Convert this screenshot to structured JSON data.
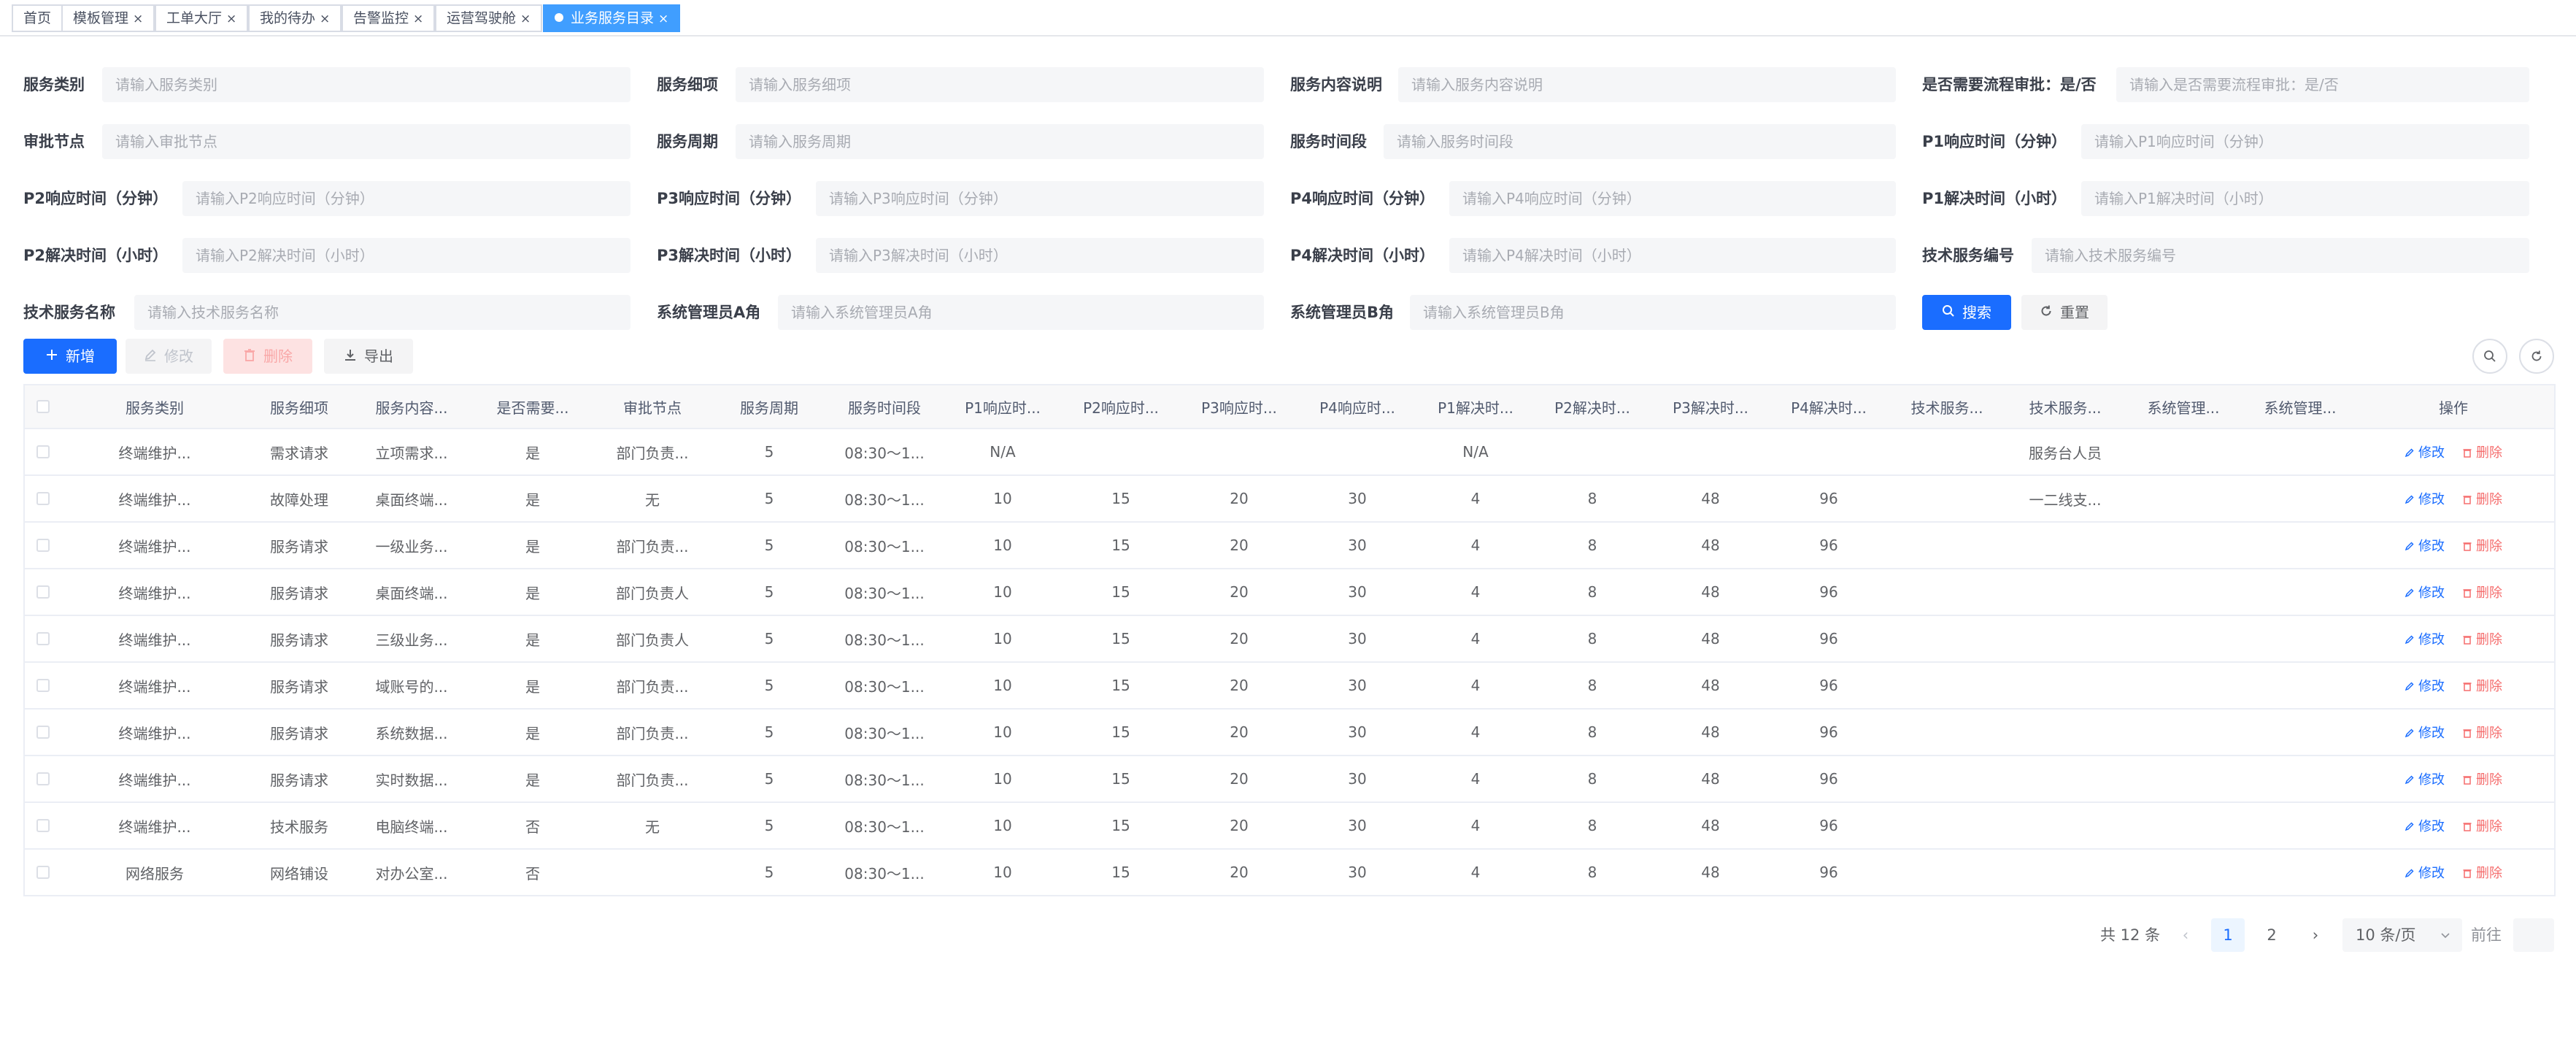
{
  "tags": [
    {
      "label": "首页",
      "closable": false,
      "active": false
    },
    {
      "label": "模板管理",
      "closable": true,
      "active": false
    },
    {
      "label": "工单大厅",
      "closable": true,
      "active": false
    },
    {
      "label": "我的待办",
      "closable": true,
      "active": false
    },
    {
      "label": "告警监控",
      "closable": true,
      "active": false
    },
    {
      "label": "运营驾驶舱",
      "closable": true,
      "active": false
    },
    {
      "label": "业务服务目录",
      "closable": true,
      "active": true
    }
  ],
  "close_glyph": "×",
  "form": {
    "fields": [
      {
        "label": "服务类别",
        "placeholder": "请输入服务类别"
      },
      {
        "label": "服务细项",
        "placeholder": "请输入服务细项"
      },
      {
        "label": "服务内容说明",
        "placeholder": "请输入服务内容说明"
      },
      {
        "label": "是否需要流程审批：是/否",
        "placeholder": "请输入是否需要流程审批：是/否"
      },
      {
        "label": "审批节点",
        "placeholder": "请输入审批节点"
      },
      {
        "label": "服务周期",
        "placeholder": "请输入服务周期"
      },
      {
        "label": "服务时间段",
        "placeholder": "请输入服务时间段"
      },
      {
        "label": "P1响应时间（分钟）",
        "placeholder": "请输入P1响应时间（分钟）"
      },
      {
        "label": "P2响应时间（分钟）",
        "placeholder": "请输入P2响应时间（分钟）"
      },
      {
        "label": "P3响应时间（分钟）",
        "placeholder": "请输入P3响应时间（分钟）"
      },
      {
        "label": "P4响应时间（分钟）",
        "placeholder": "请输入P4响应时间（分钟）"
      },
      {
        "label": "P1解决时间（小时）",
        "placeholder": "请输入P1解决时间（小时）"
      },
      {
        "label": "P2解决时间（小时）",
        "placeholder": "请输入P2解决时间（小时）"
      },
      {
        "label": "P3解决时间（小时）",
        "placeholder": "请输入P3解决时间（小时）"
      },
      {
        "label": "P4解决时间（小时）",
        "placeholder": "请输入P4解决时间（小时）"
      },
      {
        "label": "技术服务编号",
        "placeholder": "请输入技术服务编号"
      },
      {
        "label": "技术服务名称",
        "placeholder": "请输入技术服务名称"
      },
      {
        "label": "系统管理员A角",
        "placeholder": "请输入系统管理员A角"
      },
      {
        "label": "系统管理员B角",
        "placeholder": "请输入系统管理员B角"
      }
    ],
    "search_label": "搜索",
    "reset_label": "重置"
  },
  "toolbar": {
    "add_label": "新增",
    "edit_label": "修改",
    "delete_label": "删除",
    "export_label": "导出"
  },
  "table": {
    "headers": [
      "服务类别",
      "服务细项",
      "服务内容...",
      "是否需要...",
      "审批节点",
      "服务周期",
      "服务时间段",
      "P1响应时...",
      "P2响应时...",
      "P3响应时...",
      "P4响应时...",
      "P1解决时...",
      "P2解决时...",
      "P3解决时...",
      "P4解决时...",
      "技术服务...",
      "技术服务...",
      "系统管理...",
      "系统管理...",
      "操作"
    ],
    "row_edit_label": "修改",
    "row_delete_label": "删除",
    "rows": [
      [
        "终端维护...",
        "需求请求",
        "立项需求...",
        "是",
        "部门负责...",
        "5",
        "08:30～1...",
        "N/A",
        "",
        "",
        "",
        "N/A",
        "",
        "",
        "",
        "",
        "服务台人员",
        "",
        ""
      ],
      [
        "终端维护...",
        "故障处理",
        "桌面终端...",
        "是",
        "无",
        "5",
        "08:30～1...",
        "10",
        "15",
        "20",
        "30",
        "4",
        "8",
        "48",
        "96",
        "",
        "一二线支...",
        "",
        ""
      ],
      [
        "终端维护...",
        "服务请求",
        "一级业务...",
        "是",
        "部门负责...",
        "5",
        "08:30～1...",
        "10",
        "15",
        "20",
        "30",
        "4",
        "8",
        "48",
        "96",
        "",
        "",
        "",
        ""
      ],
      [
        "终端维护...",
        "服务请求",
        "桌面终端...",
        "是",
        "部门负责人",
        "5",
        "08:30～1...",
        "10",
        "15",
        "20",
        "30",
        "4",
        "8",
        "48",
        "96",
        "",
        "",
        "",
        ""
      ],
      [
        "终端维护...",
        "服务请求",
        "三级业务...",
        "是",
        "部门负责人",
        "5",
        "08:30～1...",
        "10",
        "15",
        "20",
        "30",
        "4",
        "8",
        "48",
        "96",
        "",
        "",
        "",
        ""
      ],
      [
        "终端维护...",
        "服务请求",
        "域账号的...",
        "是",
        "部门负责...",
        "5",
        "08:30～1...",
        "10",
        "15",
        "20",
        "30",
        "4",
        "8",
        "48",
        "96",
        "",
        "",
        "",
        ""
      ],
      [
        "终端维护...",
        "服务请求",
        "系统数据...",
        "是",
        "部门负责...",
        "5",
        "08:30～1...",
        "10",
        "15",
        "20",
        "30",
        "4",
        "8",
        "48",
        "96",
        "",
        "",
        "",
        ""
      ],
      [
        "终端维护...",
        "服务请求",
        "实时数据...",
        "是",
        "部门负责...",
        "5",
        "08:30～1...",
        "10",
        "15",
        "20",
        "30",
        "4",
        "8",
        "48",
        "96",
        "",
        "",
        "",
        ""
      ],
      [
        "终端维护...",
        "技术服务",
        "电脑终端...",
        "否",
        "无",
        "5",
        "08:30～1...",
        "10",
        "15",
        "20",
        "30",
        "4",
        "8",
        "48",
        "96",
        "",
        "",
        "",
        ""
      ],
      [
        "网络服务",
        "网络铺设",
        "对办公室...",
        "否",
        "",
        "5",
        "08:30～1...",
        "10",
        "15",
        "20",
        "30",
        "4",
        "8",
        "48",
        "96",
        "",
        "",
        "",
        ""
      ]
    ]
  },
  "pagination": {
    "total_label": "共 12 条",
    "pages": [
      "1",
      "2"
    ],
    "current_page": "1",
    "page_size_label": "10 条/页",
    "jump_label": "前往",
    "prev_glyph": "‹",
    "next_glyph": "›"
  },
  "colors": {
    "primary": "#1a6dff",
    "active_tag": "#409eff",
    "danger": "#f56c6c"
  }
}
